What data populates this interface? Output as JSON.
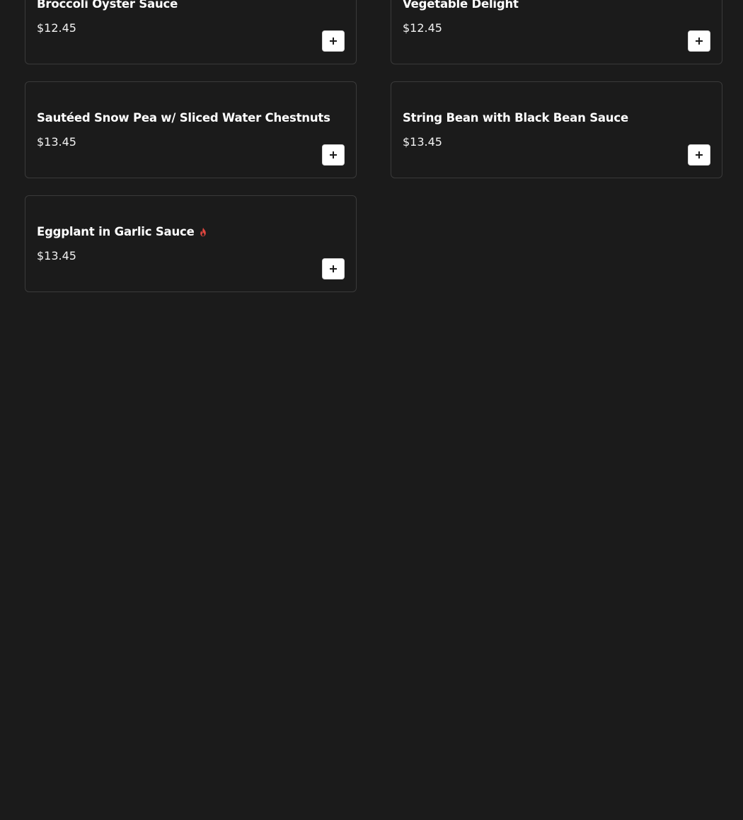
{
  "menu": {
    "items": [
      {
        "name": "Broccoli Oyster Sauce",
        "price": "$12.45",
        "spicy": false
      },
      {
        "name": "Vegetable Delight",
        "price": "$12.45",
        "spicy": false
      },
      {
        "name": "Sautéed Snow Pea w/ Sliced Water Chestnuts",
        "price": "$13.45",
        "spicy": false
      },
      {
        "name": "String Bean with Black Bean Sauce",
        "price": "$13.45",
        "spicy": false
      },
      {
        "name": "Eggplant in Garlic Sauce",
        "price": "$13.45",
        "spicy": true
      }
    ],
    "icons": {
      "add": "plus-icon",
      "spicy": "flame-icon"
    },
    "colors": {
      "background": "#1b1b1b",
      "card_border": "#3a3a3a",
      "spicy": "#e0463f",
      "add_button_bg": "#ffffff"
    }
  }
}
